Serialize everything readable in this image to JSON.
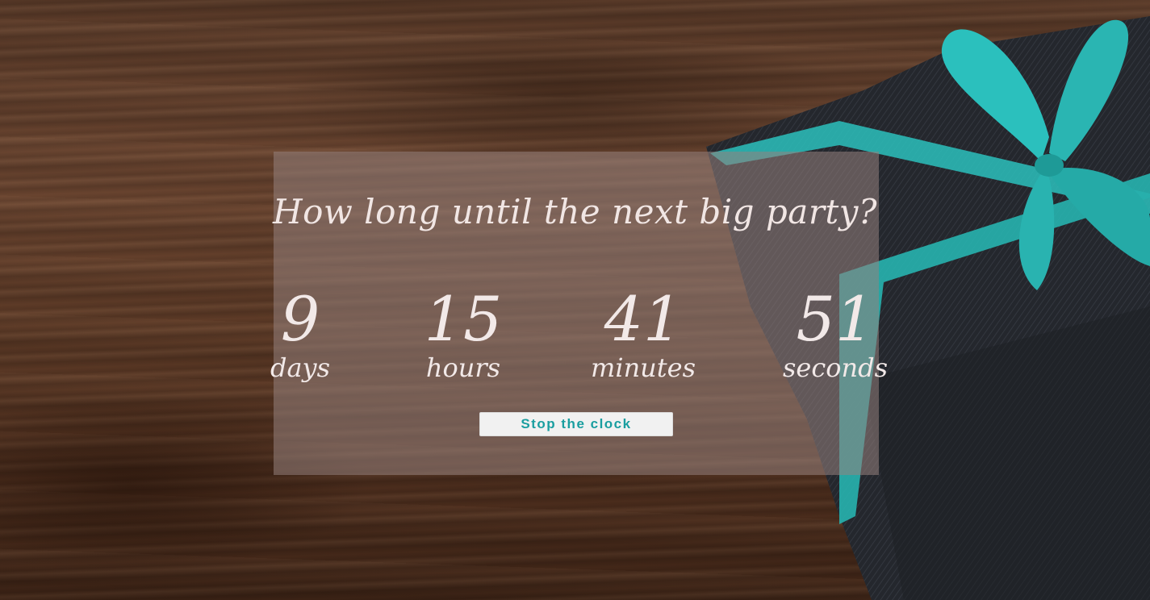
{
  "page": {
    "title": "How long until the next big party?"
  },
  "countdown": {
    "days": {
      "value": "9",
      "label": "days"
    },
    "hours": {
      "value": "15",
      "label": "hours"
    },
    "minutes": {
      "value": "41",
      "label": "minutes"
    },
    "seconds": {
      "value": "51",
      "label": "seconds"
    }
  },
  "controls": {
    "stop_label": "Stop the clock"
  },
  "colors": {
    "accent": "#1a9ea0",
    "ribbon": "#2bb8b5",
    "panel_text": "#f1e6e4",
    "wood": "#5a3a28",
    "gift_wrap": "#23262c"
  },
  "icons": {
    "background_image": "gift-box-on-wood-image"
  }
}
